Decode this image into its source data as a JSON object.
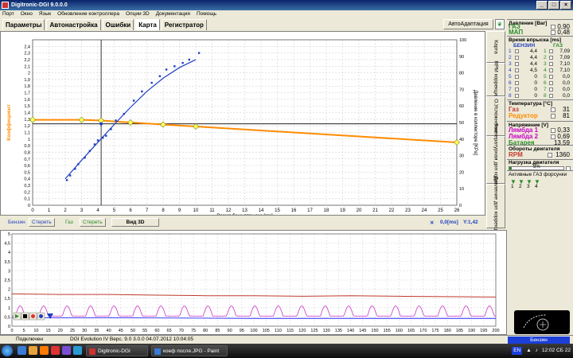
{
  "window": {
    "title": "Digitronic-DGI  9.0.0.0"
  },
  "menu": [
    "Порт",
    "Окно",
    "Язык",
    "Обновление контроллера",
    "Опции 3D",
    "Документация",
    "Помощь"
  ],
  "tabs": [
    "Параметры",
    "Автонастройка",
    "Ошибки",
    "Карта",
    "Регистратор"
  ],
  "active_tab": "Карта",
  "auto_button": "АвтоАдаптация",
  "side_tabs": [
    "Карта",
    "RPM коррекция",
    "О.Усложнение",
    "Температурная доп коррекция",
    "Давление доп коррекция"
  ],
  "map": {
    "xlabel": "Время бенз впрыска [ms]",
    "ylabel_left": "Коэффициент",
    "ylabel_right": "Давление в коллекторе [KPa]",
    "controls": {
      "benzin_label": "Бензин",
      "benzin_erase": "Стереть",
      "gas_label": "Газ",
      "gas_erase": "Стереть",
      "view3d": "Вид 3D",
      "cursor_x": "0,0[ms]",
      "cursor_y": "Y:1,42"
    }
  },
  "chart_data": [
    {
      "type": "scatter",
      "title": "",
      "xlabel": "Время бенз впрыска [ms]",
      "ylabel": "Коэффициент",
      "y2label": "Давление в коллекторе [KPa]",
      "xlim": [
        0,
        26
      ],
      "ylim": [
        0,
        2.5
      ],
      "y2lim": [
        0,
        100
      ],
      "x_ticks": [
        0,
        1,
        2,
        3,
        4,
        5,
        6,
        7,
        8,
        9,
        10,
        11,
        12,
        13,
        14,
        15,
        16,
        17,
        18,
        19,
        20,
        21,
        22,
        23,
        24,
        25,
        26
      ],
      "y_ticks": [
        0,
        0.1,
        0.2,
        0.3,
        0.4,
        0.5,
        0.6,
        0.7,
        0.8,
        0.9,
        1,
        1.1,
        1.2,
        1.3,
        1.4,
        1.5,
        1.6,
        1.7,
        1.8,
        1.9,
        2,
        2.1,
        2.2,
        2.3,
        2.4
      ],
      "y2_ticks": [
        0,
        10,
        20,
        30,
        40,
        50,
        60,
        70,
        80,
        90,
        100
      ],
      "crosshair": {
        "x": 4.2,
        "y": 1.23
      },
      "series": [
        {
          "color": "#1f3fbf",
          "points": [
            [
              2.1,
              0.38
            ],
            [
              2.3,
              0.45
            ],
            [
              2.6,
              0.55
            ],
            [
              2.8,
              0.62
            ],
            [
              3.2,
              0.72
            ],
            [
              3.5,
              0.82
            ],
            [
              3.8,
              0.92
            ],
            [
              4.0,
              0.98
            ],
            [
              4.3,
              1.02
            ],
            [
              4.5,
              1.05
            ],
            [
              4.8,
              1.15
            ],
            [
              5.1,
              1.28
            ],
            [
              5.6,
              1.38
            ],
            [
              6.2,
              1.58
            ],
            [
              6.7,
              1.72
            ],
            [
              7.3,
              1.85
            ],
            [
              7.8,
              1.95
            ],
            [
              8.2,
              2.05
            ],
            [
              8.7,
              2.1
            ],
            [
              9.2,
              2.15
            ],
            [
              9.6,
              2.2
            ],
            [
              10.2,
              2.3
            ]
          ]
        },
        {
          "color": "#1f3fbf",
          "points": [
            [
              2.0,
              0.4
            ],
            [
              3.0,
              0.68
            ],
            [
              4.0,
              0.95
            ],
            [
              5.0,
              1.22
            ],
            [
              6.0,
              1.48
            ],
            [
              7.0,
              1.72
            ],
            [
              8.0,
              1.92
            ],
            [
              9.0,
              2.08
            ],
            [
              10.0,
              2.2
            ]
          ]
        },
        {
          "color": "#ff8c00",
          "points": [
            [
              0,
              1.29
            ],
            [
              3.0,
              1.29
            ],
            [
              4.2,
              1.28
            ],
            [
              6.0,
              1.25
            ],
            [
              8.0,
              1.22
            ],
            [
              10.0,
              1.19
            ],
            [
              12.0,
              1.16
            ],
            [
              14.0,
              1.13
            ],
            [
              16.0,
              1.1
            ],
            [
              18.0,
              1.07
            ],
            [
              20.0,
              1.04
            ],
            [
              22.0,
              1.01
            ],
            [
              24.0,
              0.98
            ],
            [
              26.0,
              0.95
            ]
          ]
        },
        {
          "color": "#c8c800",
          "points": [
            [
              0,
              1.29
            ],
            [
              3.0,
              1.29
            ],
            [
              4.2,
              1.28
            ],
            [
              6.0,
              1.25
            ],
            [
              8.0,
              1.22
            ],
            [
              10.0,
              1.19
            ],
            [
              26.0,
              0.95
            ]
          ]
        }
      ]
    },
    {
      "type": "line",
      "title": "",
      "xlim": [
        0,
        200
      ],
      "ylim": [
        0,
        5
      ],
      "x_ticks": [
        0,
        5,
        10,
        15,
        20,
        25,
        30,
        35,
        40,
        45,
        50,
        55,
        60,
        65,
        70,
        75,
        80,
        85,
        90,
        95,
        100,
        105,
        110,
        115,
        120,
        125,
        130,
        135,
        140,
        145,
        150,
        155,
        160,
        165,
        170,
        175,
        180,
        185,
        190,
        195,
        200
      ],
      "y_ticks": [
        0,
        0.5,
        1,
        1.5,
        2,
        2.5,
        3,
        3.5,
        4,
        4.5,
        5
      ],
      "series": [
        {
          "color": "#c0392b",
          "values_note": "",
          "points": [
            [
              0,
              1.75
            ],
            [
              20,
              1.72
            ],
            [
              40,
              1.72
            ],
            [
              60,
              1.68
            ],
            [
              80,
              1.65
            ],
            [
              100,
              1.65
            ],
            [
              120,
              1.62
            ],
            [
              140,
              1.65
            ],
            [
              160,
              1.62
            ],
            [
              180,
              1.6
            ],
            [
              200,
              1.58
            ]
          ]
        },
        {
          "color": "#2a2aff",
          "points": [
            [
              0,
              0.45
            ],
            [
              50,
              0.45
            ],
            [
              100,
              0.42
            ],
            [
              150,
              0.42
            ],
            [
              200,
              0.42
            ]
          ]
        },
        {
          "color": "#cc33cc",
          "points": []
        }
      ]
    }
  ],
  "right_panel": {
    "pressure": {
      "title": "Давление [Bar]",
      "rows": [
        {
          "name": "ГАЗ",
          "value": "0,90"
        },
        {
          "name": "МАП",
          "value": "0,48"
        }
      ]
    },
    "injection": {
      "title": "Время впрыска [ms]",
      "col_benzin": "БЕНЗИН",
      "col_gas": "ГАЗ",
      "rows": [
        {
          "n": "1",
          "b": "4,4",
          "g": "1",
          "gv": "7,09"
        },
        {
          "n": "2",
          "b": "4,4",
          "g": "2",
          "gv": "7,09"
        },
        {
          "n": "3",
          "b": "4,4",
          "g": "3",
          "gv": "7,10"
        },
        {
          "n": "4",
          "b": "4,5",
          "g": "4",
          "gv": "7,10"
        },
        {
          "n": "5",
          "b": "0",
          "g": "5",
          "gv": "0,0"
        },
        {
          "n": "6",
          "b": "0",
          "g": "6",
          "gv": "0,0"
        },
        {
          "n": "7",
          "b": "0",
          "g": "7",
          "gv": "0,0"
        },
        {
          "n": "8",
          "b": "0",
          "g": "8",
          "gv": "0,0"
        }
      ]
    },
    "temperature": {
      "title": "Температура [°С]",
      "rows": [
        {
          "name": "Газ",
          "value": "31",
          "color": "#c0392b"
        },
        {
          "name": "Редуктор",
          "value": "81",
          "color": "#ff8c00"
        }
      ]
    },
    "voltage": {
      "title": "Напряжение [V]",
      "rows": [
        {
          "name": "Лямбда 1",
          "value": "0,33",
          "color": "#cc00cc"
        },
        {
          "name": "Лямбда 2",
          "value": "0,69",
          "color": "#cc00cc"
        },
        {
          "name": "Батарея",
          "value": "13,59",
          "color": "#2a8a2a"
        }
      ]
    },
    "rpm": {
      "title": "Обороты двигателя",
      "name": "RPM",
      "value": "1360"
    },
    "load": {
      "title": "Нагрузка двигателя",
      "value": "5%",
      "fraction": 0.05
    },
    "gas_injectors": {
      "title": "Активные ГАЗ форсунки",
      "labels": [
        "1",
        "2",
        "3",
        "4"
      ]
    }
  },
  "statusbar": {
    "connected": "Подключен",
    "version": "DGI Evolution IV  Верс. 9.0  3.0.0   04.07.2012 10:04:05",
    "fuel": "Бензин"
  },
  "taskbar": {
    "task1": "Digitronic-DGI",
    "task2": "коеф после.JPG - Paint",
    "lang": "EN",
    "clock": "12:02 СБ 22"
  },
  "colors": {
    "gas": "#c0392b",
    "orange": "#ff8c00",
    "blue": "#1f3fbf",
    "magenta": "#cc33cc",
    "fuel_badge": "#1c3fd8"
  }
}
